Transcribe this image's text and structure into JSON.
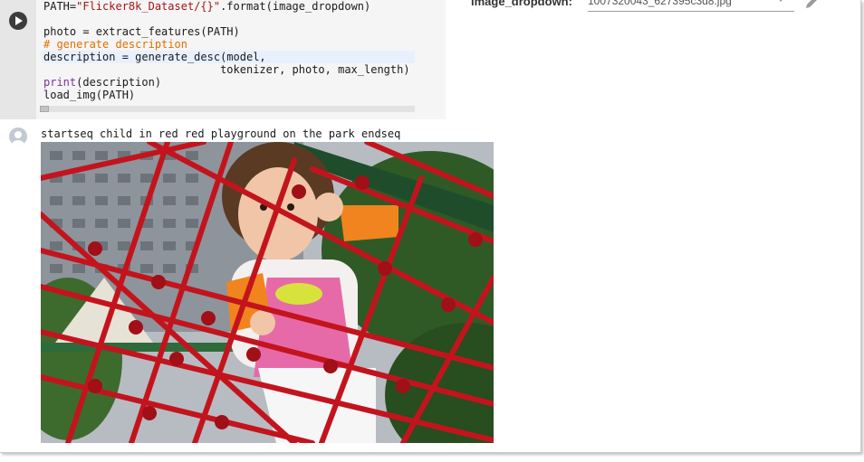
{
  "code_cell": {
    "lines": [
      {
        "text": "PATH=\"Flicker8k_Dataset/{}\".format(image_dropdown)"
      },
      {
        "text": ""
      },
      {
        "text": "photo = extract_features(PATH)"
      },
      {
        "text": "# generate description"
      },
      {
        "text": "description = generate_desc(model,"
      },
      {
        "text": "                           tokenizer, photo, max_length)"
      },
      {
        "text": "print(description)"
      },
      {
        "text": "load_img(PATH)"
      }
    ],
    "p1_pre": "PATH=",
    "p1_str": "\"Flicker8k_Dataset/{}\"",
    "p1_post": ".format(image_dropdown)",
    "p7_kw": "print",
    "p7_post": "(description)"
  },
  "form": {
    "label": "image_dropdown:",
    "value": "1007320043_627395c3d8.jpg"
  },
  "output": {
    "caption": "startseq child in red red playground on the park endseq"
  },
  "icons": {
    "run": "play-icon",
    "edit": "pencil-icon",
    "output": "avatar-icon"
  },
  "colors": {
    "code_background": "#f5f5f5",
    "gutter_background": "#e6e6e6",
    "string": "#a31515",
    "comment": "#e07000",
    "keyword": "#7b30a8"
  }
}
